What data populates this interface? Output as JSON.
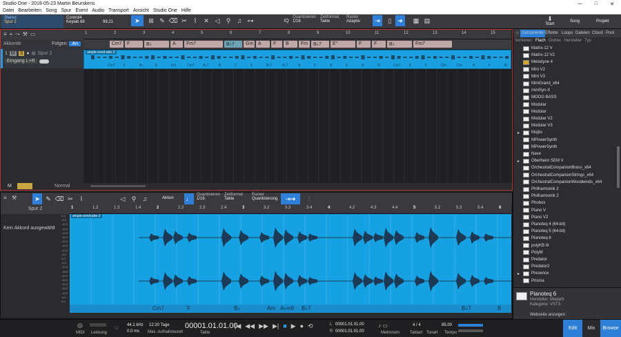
{
  "window": {
    "title": "Studio One - 2018-05-23 Martin Beurskens",
    "controls": [
      "—",
      "□",
      "✕"
    ]
  },
  "menu": [
    "Datei",
    "Bearbeiten",
    "Song",
    "Spur",
    "Event",
    "Audio",
    "Transport",
    "Ansicht",
    "Studio One",
    "Hilfe"
  ],
  "toolbar": {
    "output": "Stereo",
    "track": "Spur 2",
    "device": "Control4",
    "keylab": "Keylab 88",
    "value": "99,21",
    "quantize_label": "Quantisieren",
    "quantize_value": "1/16",
    "timeformat_label": "Zeitformat",
    "timeformat_value": "Takte",
    "raster_label": "Raster",
    "raster_value": "Adaptiv",
    "start": "Start",
    "song": "Song",
    "projekt": "Projekt"
  },
  "arrange": {
    "akkorde": "Akkorde",
    "folgen": "Folgen:",
    "folgen_value": "An",
    "track_name": "Spur 2",
    "track_num": "1",
    "input": "Eingang L+R",
    "clip_name": "ample-sond-abe-3",
    "bottom_m": "M",
    "bottom_normal": "Normal",
    "ruler": [
      "1",
      "2",
      "3",
      "4",
      "5",
      "6",
      "7",
      "8",
      "9",
      "10",
      "11",
      "12",
      "13",
      "14",
      "15"
    ],
    "chords": [
      "Cm7",
      "F",
      "B♭",
      "A",
      "Fm7",
      "B♭7",
      "Gm",
      "A",
      "F",
      "B",
      "Fm",
      "B♭7",
      "E°",
      "F",
      "F",
      "B♭",
      "Fm7"
    ],
    "clip_chords": [
      "Cm7",
      "F",
      "A♭",
      "E",
      "Fm",
      "Cm7",
      "A♭7",
      "B",
      "C",
      "E",
      "B♭7",
      "A♭7",
      "A",
      "F",
      "A",
      "E",
      "A",
      "G",
      "Cm7",
      "E",
      "F",
      "Gm",
      "Cm",
      "A",
      "F",
      "B♭"
    ]
  },
  "editor": {
    "track_name": "Spur 2",
    "no_chord": "Kein Akkord ausgewählt",
    "aktion": "Aktion",
    "quantize_label": "Quantisieren",
    "quantize_value": "1/16",
    "timeformat_label": "Zeitformat",
    "timeformat_value": "Takte",
    "raster_label": "Raster",
    "raster_value": "Quantisierung",
    "clip_name": "ample-sond-abe-3",
    "ruler": [
      "1",
      "1.2",
      "1.3",
      "1.4",
      "2",
      "2.2",
      "2.3",
      "2.4",
      "3",
      "3.2",
      "3.3",
      "3.4",
      "4",
      "4.2",
      "4.3",
      "4.4",
      "5",
      "5.2",
      "5.3",
      "5.4",
      "6"
    ],
    "db_labels": [
      "0.0",
      "-6.0",
      "-12.0",
      "-18.0",
      "-24.0",
      "-30.0",
      "-24.0",
      "-18.0",
      "-12.0",
      "-6.0",
      "0.0",
      "-6.0",
      "-12.0",
      "-18.0",
      "-24.0",
      "-30.0",
      "-24.0",
      "-18.0",
      "-12.0",
      "-6.0",
      "0.0"
    ],
    "chords": [
      "Cm7",
      "F",
      "B♭",
      "Am",
      "A♭m6",
      "B♭7",
      "B♭7",
      "B"
    ]
  },
  "browser": {
    "tabs": [
      "Instrumente",
      "Effekte",
      "Loops",
      "Dateien",
      "Cloud",
      "Pool"
    ],
    "sort_label": "Sortieren:",
    "sort_options": [
      "Flach",
      "Ordner",
      "Hersteller",
      "Typ"
    ],
    "items": [
      "Matrix-12 V",
      "Matrix-12 V2",
      "Melodyne 4",
      "Mini V2",
      "Mini V3",
      "MiniGrand_x64",
      "miniSyn-X",
      "MOOG BASS",
      "Modular",
      "Modular",
      "Modular V2",
      "Modular V3",
      "Mojito",
      "MPowerSynth",
      "MPowerSynth",
      "Nave",
      "Oberheim SEM V",
      "OrchestralCompanionBrass_x64",
      "OrchestralCompanionStrings_x64",
      "OrchestralCompanionWoodwinds_x64",
      "Philharmonik 2",
      "Philharmonik 2",
      "Phobos",
      "Piano V",
      "Piano V2",
      "Pianoteq 4 (64-bit)",
      "Pianoteq 5 (64-bit)",
      "Pianoteq 6",
      "polyKB III",
      "PolyM",
      "Predator",
      "Predator2",
      "Presence",
      "Prisma"
    ],
    "selected_title": "Pianoteq 6",
    "selected_vendor": "Hersteller: Modartt",
    "selected_category": "Kategorie: VST3",
    "website": "Webseite anzeigen"
  },
  "transport": {
    "midi": "MIDI",
    "leistung": "Leistung",
    "samplerate": "44.1 kHz",
    "latency": "0.0 ms",
    "days": "12:20 Tage",
    "max_rec": "Max. Aufnahmezeit",
    "position": "00001.01.01.00",
    "takte": "Takte",
    "loop_l": "00001.01.01.00",
    "loop_r": "00001.01.01.00",
    "metronom": "Metronom",
    "taktart": "4 / 4",
    "taktart_label": "Taktart",
    "tonart": "Tonart",
    "tempo": "85.00",
    "tempo_label": "Tempo",
    "edit": "Edit",
    "mix": "Mix",
    "browse": "Browse"
  },
  "colors": {
    "accent": "#2e7fd8",
    "clip": "#16a1e2",
    "chord": "#c0a8a8"
  }
}
